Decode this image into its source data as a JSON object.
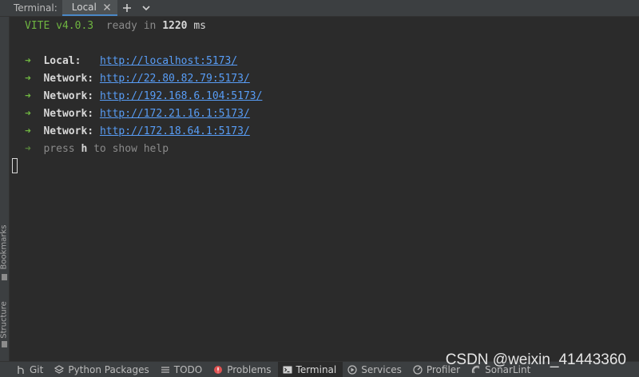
{
  "tabbar": {
    "title": "Terminal:",
    "tab_label": "Local",
    "add_symbol": "+",
    "menu_symbol": "⌄"
  },
  "sidebar": {
    "bookmarks_label": "Bookmarks",
    "structure_label": "Structure"
  },
  "terminal": {
    "vite_name": "VITE v4.0.3",
    "ready_text": "ready in",
    "ready_ms": "1220",
    "ready_unit": "ms",
    "arrow": "➜",
    "servers": [
      {
        "label": "Local:",
        "url": "http://localhost:5173/"
      },
      {
        "label": "Network:",
        "url": "http://22.80.82.79:5173/"
      },
      {
        "label": "Network:",
        "url": "http://192.168.6.104:5173/"
      },
      {
        "label": "Network:",
        "url": "http://172.21.16.1:5173/"
      },
      {
        "label": "Network:",
        "url": "http://172.18.64.1:5173/"
      }
    ],
    "help_prefix": "press",
    "help_key": "h",
    "help_suffix": "to show help"
  },
  "statusbar": {
    "items": [
      {
        "label": "Git",
        "icon": "git-icon"
      },
      {
        "label": "Python Packages",
        "icon": "layers-icon"
      },
      {
        "label": "TODO",
        "icon": "list-icon"
      },
      {
        "label": "Problems",
        "icon": "error-icon"
      },
      {
        "label": "Terminal",
        "icon": "terminal-icon"
      },
      {
        "label": "Services",
        "icon": "services-icon"
      },
      {
        "label": "Profiler",
        "icon": "profiler-icon"
      },
      {
        "label": "SonarLint",
        "icon": "sonarlint-icon"
      }
    ]
  },
  "watermark": "CSDN @weixin_41443360",
  "colors": {
    "background": "#2b2b2b",
    "vite_green": "#6fb541",
    "url_blue": "#589df6",
    "error_red": "#e05252"
  }
}
